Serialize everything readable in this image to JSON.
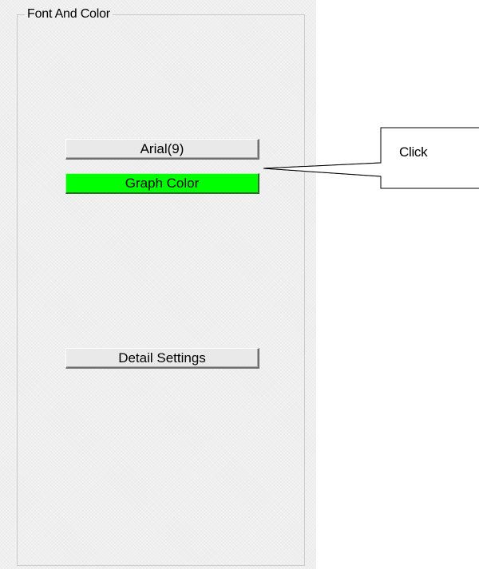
{
  "group": {
    "title": "Font And Color"
  },
  "buttons": {
    "font_label": "Arial(9)",
    "graph_color_label": "Graph Color",
    "detail_settings_label": "Detail Settings"
  },
  "callout": {
    "text": "Click"
  },
  "colors": {
    "graph_color_swatch": "#00ff00",
    "panel_background": "#efefef"
  }
}
